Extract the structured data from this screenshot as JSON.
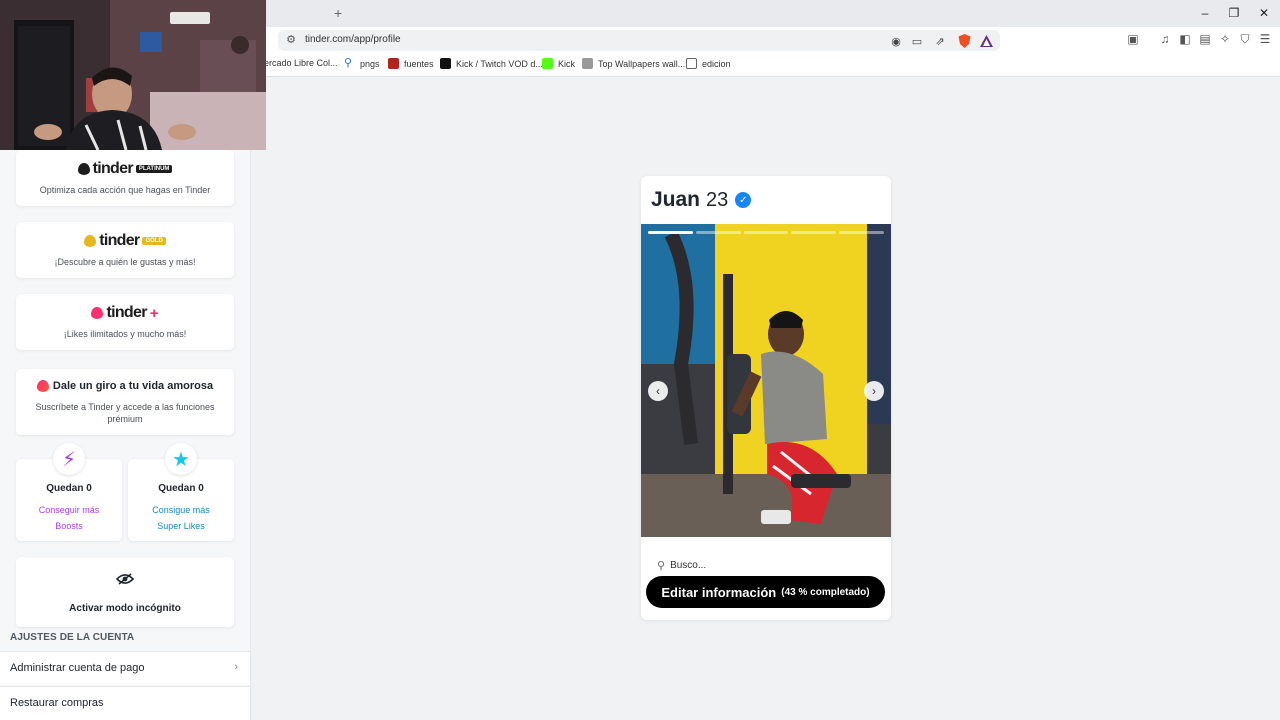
{
  "browser": {
    "new_tab_label": "+",
    "url": "tinder.com/app/profile",
    "window_controls": {
      "minimize": "–",
      "maximize": "❐",
      "close": "✕"
    },
    "bookmarks": [
      {
        "label": "ercado Libre Col...",
        "color": "#f3d33f"
      },
      {
        "label": "pngs",
        "color": "#1c77d3"
      },
      {
        "label": "fuentes",
        "color": "#b3221c"
      },
      {
        "label": "Kick / Twitch VOD d...",
        "color": "#111111"
      },
      {
        "label": "Kick",
        "color": "#53fc18"
      },
      {
        "label": "Top Wallpapers wall...",
        "color": "#888888"
      },
      {
        "label": "edicion",
        "color": "#dddddd"
      }
    ]
  },
  "sidebar": {
    "platinum": {
      "logo": "tinder",
      "badge": "PLATINUM",
      "subtitle": "Optimiza cada acción que hagas en Tinder"
    },
    "gold": {
      "logo": "tinder",
      "badge": "GOLD",
      "subtitle": "¡Descubre a quién le gustas y más!"
    },
    "plus": {
      "logo": "tinder",
      "suffix": "+",
      "subtitle": "¡Likes ilimitados y mucho más!"
    },
    "promo": {
      "title": "Dale un giro a tu vida amorosa",
      "subtitle": "Suscríbete a Tinder y accede a las funciones prémium"
    },
    "boosts": {
      "remaining": "Quedan 0",
      "action_line1": "Conseguir más",
      "action_line2": "Boosts"
    },
    "superlikes": {
      "remaining": "Quedan 0",
      "action_line1": "Consigue más",
      "action_line2": "Super Likes"
    },
    "incognito": {
      "label": "Activar modo incógnito"
    },
    "section_header": "AJUSTES DE LA CUENTA",
    "settings": [
      {
        "label": "Administrar cuenta de pago"
      },
      {
        "label": "Restaurar compras"
      }
    ]
  },
  "profile": {
    "name": "Juan",
    "age": "23",
    "verified": true,
    "photo_count": 5,
    "active_photo": 1,
    "search_label": "Busco...",
    "edit_button": "Editar información",
    "edit_progress": "(43 % completado)"
  },
  "colors": {
    "tinder_pink": "#fd2f6e",
    "gold": "#e6b81e",
    "boost_purple": "#a83cf0",
    "superlike_blue": "#17c9e8",
    "verified_blue": "#1786f8"
  }
}
